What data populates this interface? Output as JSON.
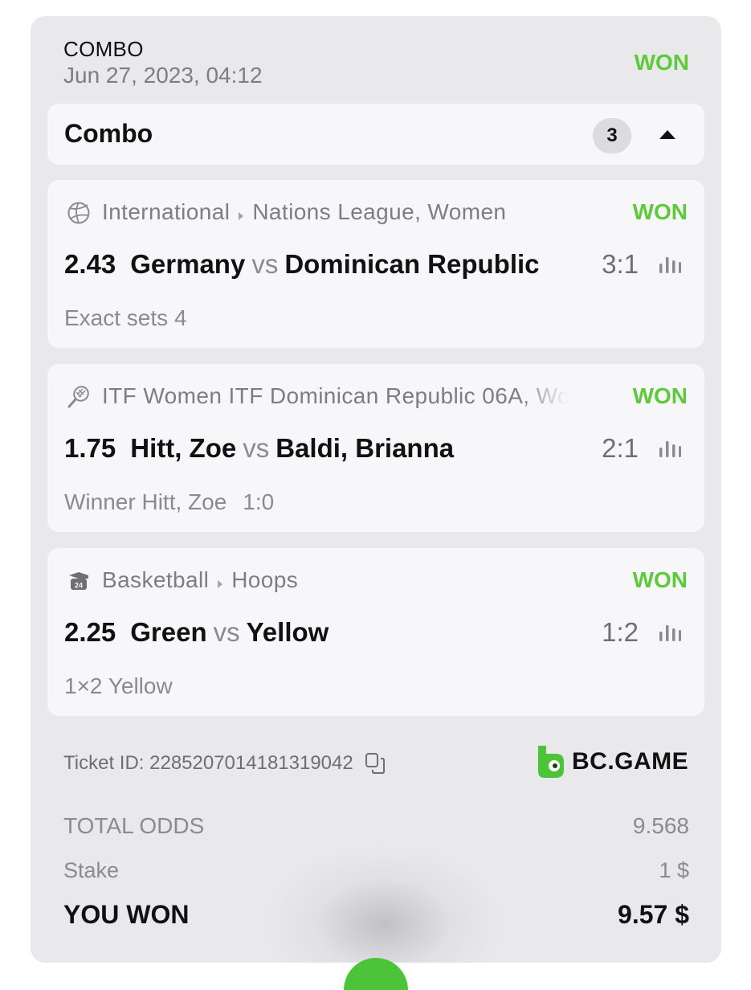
{
  "header": {
    "type": "COMBO",
    "date": "Jun 27, 2023, 04:12",
    "status": "WON"
  },
  "combo": {
    "title": "Combo",
    "count": "3"
  },
  "events": [
    {
      "icon": "volleyball-icon",
      "category": "International",
      "tournament": "Nations League, Women",
      "status": "WON",
      "odds": "2.43",
      "home": "Germany",
      "vs": "vs",
      "away": "Dominican Republic",
      "score": "3:1",
      "market": "Exact sets 4",
      "market_score": ""
    },
    {
      "icon": "tennis-racket-icon",
      "category": "ITF Women ITF Dominican Republic 06A, Wo",
      "tournament": "",
      "status": "WON",
      "odds": "1.75",
      "home": "Hitt, Zoe",
      "vs": "vs",
      "away": "Baldi, Brianna",
      "score": "2:1",
      "market": "Winner Hitt, Zoe",
      "market_score": "1:0"
    },
    {
      "icon": "basketball-24-icon",
      "category": "Basketball",
      "tournament": "Hoops",
      "status": "WON",
      "odds": "2.25",
      "home": "Green",
      "vs": "vs",
      "away": "Yellow",
      "score": "1:2",
      "market": "1×2 Yellow",
      "market_score": ""
    }
  ],
  "ticket": {
    "id_label": "Ticket ID: 2285207014181319042"
  },
  "brand": {
    "name": "BC.GAME",
    "color": "#4cc43a"
  },
  "summary": {
    "total_odds_label": "TOTAL ODDS",
    "total_odds_value": "9.568",
    "stake_label": "Stake",
    "stake_value": "1 $",
    "won_label": "YOU WON",
    "won_value": "9.57 $"
  },
  "colors": {
    "won": "#5ec93a",
    "card_bg": "#e9e9ec",
    "inner_bg": "#f7f7f9"
  }
}
